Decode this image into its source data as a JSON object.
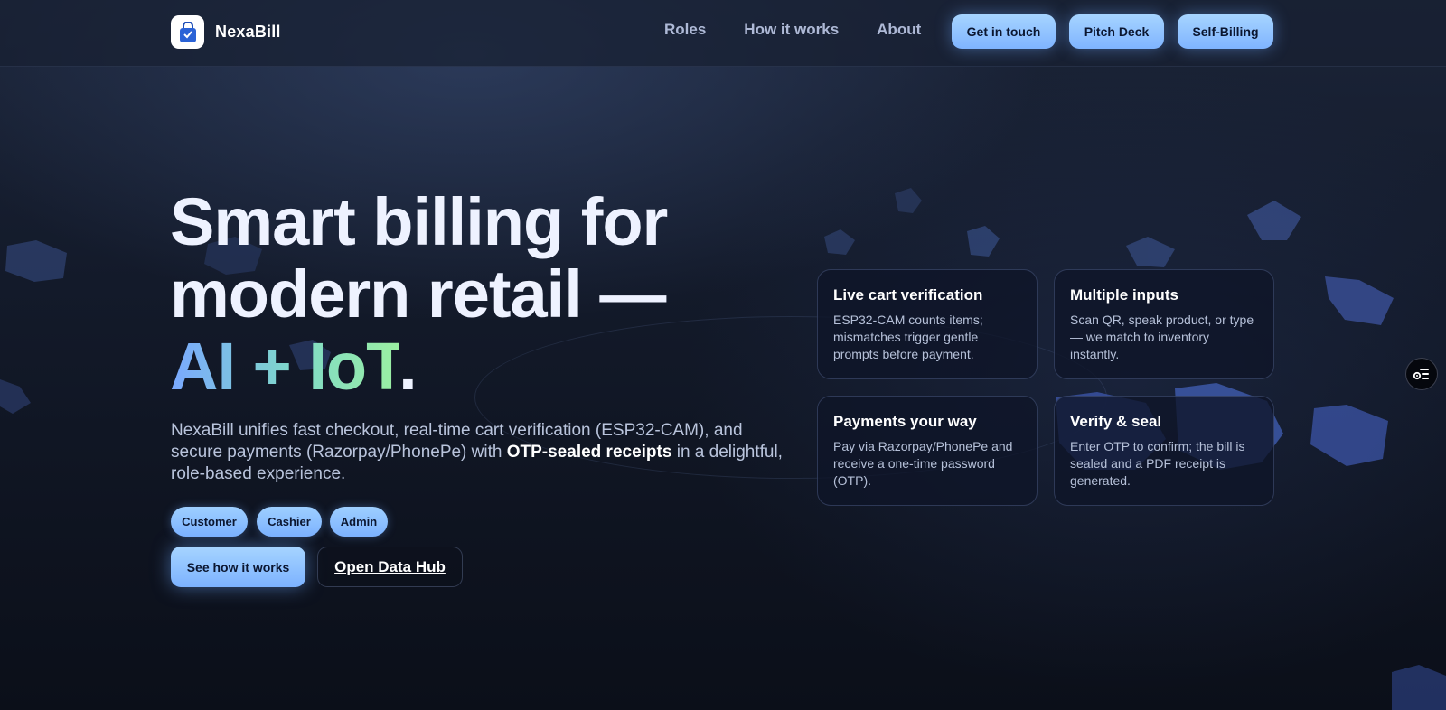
{
  "brand": {
    "name": "NexaBill",
    "logo_icon": "shopping-bag-icon"
  },
  "nav": {
    "links": [
      "Roles",
      "How it works",
      "About"
    ],
    "buttons": [
      "Get in touch",
      "Pitch Deck",
      "Self-Billing"
    ]
  },
  "hero": {
    "title_line1": "Smart billing for",
    "title_line2": "modern retail —",
    "title_highlight": "AI + IoT",
    "title_end": ".",
    "desc_part1": "NexaBill unifies fast checkout, real-time cart verification (ESP32-CAM), and secure payments (Razorpay/PhonePe) with ",
    "desc_bold": "OTP-sealed receipts",
    "desc_part2": " in a delightful, role-based experience.",
    "roles": [
      "Customer",
      "Cashier",
      "Admin"
    ],
    "cta_primary": "See how it works",
    "cta_secondary": "Open Data Hub"
  },
  "features": [
    {
      "title": "Live cart verification",
      "text": "ESP32-CAM counts items; mismatches trigger gentle prompts before payment."
    },
    {
      "title": "Multiple inputs",
      "text": "Scan QR, speak product, or type — we match to inventory instantly."
    },
    {
      "title": "Payments your way",
      "text": "Pay via Razorpay/PhonePe and receive a one-time password (OTP)."
    },
    {
      "title": "Verify & seal",
      "text": "Enter OTP to confirm; the bill is sealed and a PDF receipt is generated."
    }
  ],
  "side_button": {
    "icon": "list-settings-icon"
  },
  "colors": {
    "accent": "#7fb4ff",
    "accent_light": "#a6d4ff",
    "gradient_start": "#7aa8ff",
    "gradient_end": "#9bf0a2",
    "background": "#0b0f19"
  }
}
